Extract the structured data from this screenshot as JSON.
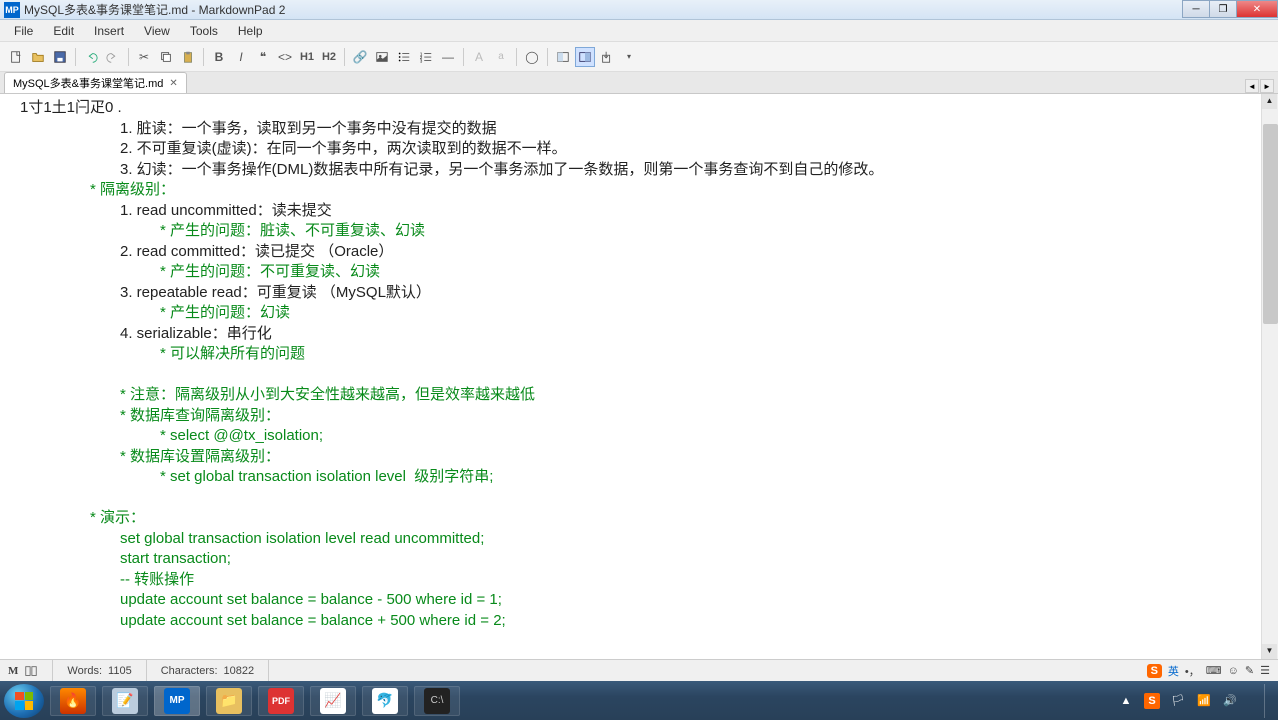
{
  "titlebar": {
    "icon_text": "MP",
    "title": "MySQL多表&事务课堂笔记.md - MarkdownPad 2"
  },
  "menu": {
    "file": "File",
    "edit": "Edit",
    "insert": "Insert",
    "view": "View",
    "tools": "Tools",
    "help": "Help"
  },
  "toolbar": {
    "h1": "H1",
    "h2": "H2",
    "bold": "B",
    "italic": "I",
    "a_big": "A",
    "a_small": "a"
  },
  "tab": {
    "name": "MySQL多表&事务课堂笔记.md"
  },
  "editor": {
    "l0": "1寸1土1闩疋0 .",
    "l1": "1. 脏读：一个事务，读取到另一个事务中没有提交的数据",
    "l2": "2. 不可重复读(虚读)：在同一个事务中，两次读取到的数据不一样。",
    "l3": "3. 幻读：一个事务操作(DML)数据表中所有记录，另一个事务添加了一条数据，则第一个事务查询不到自己的修改。",
    "l4": "* 隔离级别：",
    "l5": "1. read uncommitted：读未提交",
    "l6": "* 产生的问题：脏读、不可重复读、幻读",
    "l7": "2. read committed：读已提交 （Oracle）",
    "l8": "* 产生的问题：不可重复读、幻读",
    "l9": "3. repeatable read：可重复读 （MySQL默认）",
    "l10": "* 产生的问题：幻读",
    "l11": "4. serializable：串行化",
    "l12": "* 可以解决所有的问题",
    "l13": "* 注意：隔离级别从小到大安全性越来越高，但是效率越来越低",
    "l14": "* 数据库查询隔离级别：",
    "l15": "* select @@tx_isolation;",
    "l16": "* 数据库设置隔离级别：",
    "l17": "* set global transaction isolation level  级别字符串;",
    "l18": "* 演示：",
    "l19": "set global transaction isolation level read uncommitted;",
    "l20": "start transaction;",
    "l21": "-- 转账操作",
    "l22": "update account set balance = balance - 500 where id = 1;",
    "l23": "update account set balance = balance + 500 where id = 2;"
  },
  "status": {
    "m_icon": "M",
    "words_label": "Words:",
    "words_val": "1105",
    "chars_label": "Characters:",
    "chars_val": "10822",
    "lang": "英",
    "ime_glyph": "S"
  },
  "taskbar": {
    "mp_text": "MP",
    "pdf_text": "PDF"
  },
  "tray": {
    "time": " ",
    "arrow": "▲"
  }
}
